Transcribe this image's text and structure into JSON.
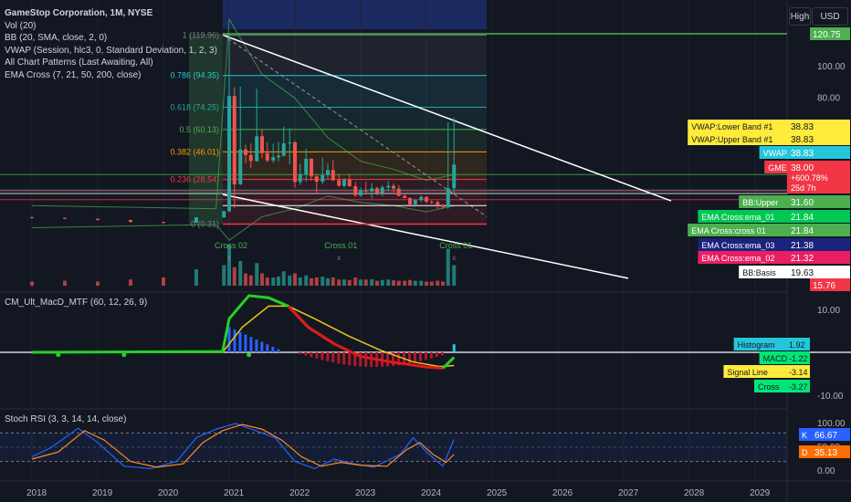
{
  "header": {
    "symbol_line": "GameStop Corporation, 1M, NYSE",
    "indicators": [
      "Vol (20)",
      "BB (20, SMA, close, 2, 0)",
      "VWAP (Session, hlc3, 0, Standard Deviation, 1, 2, 3)",
      "All Chart Patterns (Last Awaiting, All)",
      "EMA Cross (7, 21, 50, 200, close)"
    ],
    "high_button": "High",
    "currency_button": "USD"
  },
  "macd_pane": {
    "legend": "CM_Ult_MacD_MTF (60, 12, 26, 9)"
  },
  "rsi_pane": {
    "legend": "Stoch RSI (3, 3, 14, 14, close)"
  },
  "colors": {
    "background": "#131722",
    "grid": "#1e222d",
    "up": "#26a69a",
    "down": "#ef5350",
    "macd_up": "#26d026",
    "macd_down": "#e0181b",
    "signal": "#f0c419",
    "hist_up": "#2962ff",
    "hist_down": "#b2182b",
    "k_line": "#2962ff",
    "d_line": "#ff8a28",
    "top_band": "#1c2d6b"
  },
  "chart_data": [
    {
      "type": "candlestick",
      "pane": "price",
      "x_ticks": [
        "2018",
        "2019",
        "2020",
        "2021",
        "2022",
        "2023",
        "2024",
        "2025",
        "2026",
        "2027",
        "2028",
        "2029"
      ],
      "y_ticks": [
        "100.00",
        "80.00"
      ],
      "series": [
        {
          "t": 2018.0,
          "o": 4.6,
          "h": 5.2,
          "l": 3.9,
          "c": 4.2
        },
        {
          "t": 2018.5,
          "o": 4.2,
          "h": 4.5,
          "l": 3.4,
          "c": 3.6
        },
        {
          "t": 2019.0,
          "o": 3.6,
          "h": 3.8,
          "l": 2.6,
          "c": 2.9
        },
        {
          "t": 2019.5,
          "o": 2.9,
          "h": 3.1,
          "l": 1.4,
          "c": 1.6
        },
        {
          "t": 2020.0,
          "o": 1.6,
          "h": 1.8,
          "l": 0.7,
          "c": 1.2
        },
        {
          "t": 2020.5,
          "o": 1.2,
          "h": 4.8,
          "l": 1.1,
          "c": 4.5
        },
        {
          "t": 2020.92,
          "o": 4.5,
          "h": 8.8,
          "l": 4.3,
          "c": 8.4
        },
        {
          "t": 2021.0,
          "o": 8.4,
          "h": 120.75,
          "l": 7.8,
          "c": 81.3
        },
        {
          "t": 2021.08,
          "o": 81.3,
          "h": 87.0,
          "l": 10.2,
          "c": 25.4
        },
        {
          "t": 2021.17,
          "o": 25.4,
          "h": 87.3,
          "l": 25.0,
          "c": 47.5
        },
        {
          "t": 2021.25,
          "o": 47.5,
          "h": 50.6,
          "l": 38.8,
          "c": 44.0
        },
        {
          "t": 2021.33,
          "o": 44.0,
          "h": 51.4,
          "l": 35.6,
          "c": 40.2
        },
        {
          "t": 2021.42,
          "o": 40.2,
          "h": 86.0,
          "l": 39.6,
          "c": 55.9
        },
        {
          "t": 2021.5,
          "o": 55.9,
          "h": 60.5,
          "l": 42.0,
          "c": 45.2
        },
        {
          "t": 2021.58,
          "o": 45.2,
          "h": 52.2,
          "l": 39.5,
          "c": 40.6
        },
        {
          "t": 2021.67,
          "o": 40.6,
          "h": 51.2,
          "l": 39.0,
          "c": 42.6
        },
        {
          "t": 2021.75,
          "o": 42.6,
          "h": 52.3,
          "l": 40.0,
          "c": 43.6
        },
        {
          "t": 2021.83,
          "o": 43.6,
          "h": 62.0,
          "l": 43.0,
          "c": 51.4
        },
        {
          "t": 2021.92,
          "o": 51.4,
          "h": 60.9,
          "l": 38.0,
          "c": 52.0
        },
        {
          "t": 2022.0,
          "o": 52.0,
          "h": 53.0,
          "l": 23.4,
          "c": 26.9
        },
        {
          "t": 2022.08,
          "o": 26.9,
          "h": 38.6,
          "l": 25.0,
          "c": 31.8
        },
        {
          "t": 2022.17,
          "o": 31.8,
          "h": 48.0,
          "l": 27.0,
          "c": 41.6
        },
        {
          "t": 2022.25,
          "o": 41.6,
          "h": 42.0,
          "l": 27.7,
          "c": 30.5
        },
        {
          "t": 2022.33,
          "o": 30.5,
          "h": 32.0,
          "l": 19.5,
          "c": 27.1
        },
        {
          "t": 2022.42,
          "o": 27.1,
          "h": 42.3,
          "l": 25.5,
          "c": 31.3
        },
        {
          "t": 2022.5,
          "o": 31.3,
          "h": 38.8,
          "l": 28.6,
          "c": 34.5
        },
        {
          "t": 2022.58,
          "o": 34.5,
          "h": 40.9,
          "l": 27.6,
          "c": 28.0
        },
        {
          "t": 2022.67,
          "o": 28.0,
          "h": 32.0,
          "l": 24.0,
          "c": 24.5
        },
        {
          "t": 2022.75,
          "o": 24.5,
          "h": 29.5,
          "l": 23.3,
          "c": 28.3
        },
        {
          "t": 2022.83,
          "o": 28.3,
          "h": 32.0,
          "l": 24.0,
          "c": 24.2
        },
        {
          "t": 2022.92,
          "o": 24.2,
          "h": 27.0,
          "l": 17.6,
          "c": 18.4
        },
        {
          "t": 2023.0,
          "o": 18.4,
          "h": 23.5,
          "l": 17.5,
          "c": 21.5
        },
        {
          "t": 2023.08,
          "o": 21.5,
          "h": 27.0,
          "l": 19.0,
          "c": 20.9
        },
        {
          "t": 2023.17,
          "o": 20.9,
          "h": 26.3,
          "l": 16.6,
          "c": 23.0
        },
        {
          "t": 2023.25,
          "o": 23.0,
          "h": 24.0,
          "l": 18.5,
          "c": 20.1
        },
        {
          "t": 2023.33,
          "o": 20.1,
          "h": 25.0,
          "l": 17.8,
          "c": 23.5
        },
        {
          "t": 2023.42,
          "o": 23.5,
          "h": 27.6,
          "l": 21.0,
          "c": 24.5
        },
        {
          "t": 2023.5,
          "o": 24.5,
          "h": 26.0,
          "l": 20.6,
          "c": 22.8
        },
        {
          "t": 2023.58,
          "o": 22.8,
          "h": 25.0,
          "l": 17.9,
          "c": 18.1
        },
        {
          "t": 2023.67,
          "o": 18.1,
          "h": 20.0,
          "l": 16.5,
          "c": 16.8
        },
        {
          "t": 2023.75,
          "o": 16.8,
          "h": 17.2,
          "l": 12.1,
          "c": 12.7
        },
        {
          "t": 2023.83,
          "o": 12.7,
          "h": 16.0,
          "l": 11.0,
          "c": 15.5
        },
        {
          "t": 2023.92,
          "o": 15.5,
          "h": 18.5,
          "l": 14.2,
          "c": 17.5
        },
        {
          "t": 2024.0,
          "o": 17.5,
          "h": 18.0,
          "l": 13.2,
          "c": 14.5
        },
        {
          "t": 2024.08,
          "o": 14.5,
          "h": 15.2,
          "l": 13.0,
          "c": 14.2
        },
        {
          "t": 2024.17,
          "o": 14.2,
          "h": 15.0,
          "l": 10.0,
          "c": 12.5
        },
        {
          "t": 2024.25,
          "o": 12.5,
          "h": 13.0,
          "l": 9.95,
          "c": 11.1
        },
        {
          "t": 2024.33,
          "o": 11.1,
          "h": 64.8,
          "l": 10.0,
          "c": 23.0
        },
        {
          "t": 2024.42,
          "o": 23.0,
          "h": 67.5,
          "l": 20.1,
          "c": 38.0
        }
      ],
      "fibonacci": [
        {
          "label": "1 (119.96)",
          "value": 119.96,
          "color": "#787b86"
        },
        {
          "label": "0.786 (94.35)",
          "value": 94.35,
          "color": "#26c6da"
        },
        {
          "label": "0.618 (74.25)",
          "value": 74.25,
          "color": "#26a69a"
        },
        {
          "label": "0.5 (60.13)",
          "value": 60.13,
          "color": "#4caf50"
        },
        {
          "label": "0.382 (46.01)",
          "value": 46.01,
          "color": "#ff9800"
        },
        {
          "label": "0.236 (28.54)",
          "value": 28.54,
          "color": "#f23645"
        },
        {
          "label": "0 (0.31)",
          "value": 0.31,
          "color": "#787b86"
        }
      ],
      "cross_labels": [
        "Cross 02",
        "Cross 01",
        "Cross 01"
      ],
      "price_labels": [
        {
          "text": "120.75",
          "value": 120.75,
          "bg": "#4caf50",
          "fg": "#ffffff"
        },
        {
          "text": "VWAP:Lower Band #1",
          "value2": "38.83",
          "bg": "#ffeb3b",
          "fg": "#131722"
        },
        {
          "text": "VWAP:Upper Band #1",
          "value2": "38.83",
          "bg": "#ffeb3b",
          "fg": "#131722"
        },
        {
          "text": "VWAP",
          "value2": "38.83",
          "bg": "#26c6da",
          "fg": "#ffffff"
        },
        {
          "text": "GME",
          "value2": "38.00",
          "extra": [
            "+600.78%",
            "25d 7h"
          ],
          "bg": "#f23645",
          "fg": "#ffffff"
        },
        {
          "text": "BB:Upper",
          "value2": "31.60",
          "bg": "#4caf50",
          "fg": "#ffffff"
        },
        {
          "text": "EMA Cross:ema_01",
          "value2": "21.84",
          "bg": "#00c853",
          "fg": "#ffffff"
        },
        {
          "text": "EMA Cross:cross 01",
          "value2": "21.84",
          "bg": "#4caf50",
          "fg": "#ffffff"
        },
        {
          "text": "EMA Cross:ema_03",
          "value2": "21.38",
          "bg": "#1a237e",
          "fg": "#ffffff"
        },
        {
          "text": "EMA Cross:ema_02",
          "value2": "21.32",
          "bg": "#e91e63",
          "fg": "#ffffff"
        },
        {
          "text": "BB:Basis",
          "value2": "19.63",
          "bg": "#ffffff",
          "fg": "#131722"
        },
        {
          "text": "15.76",
          "bg": "#f23645",
          "fg": "#ffffff"
        }
      ]
    },
    {
      "type": "line",
      "pane": "macd",
      "y_ticks": [
        "10.00",
        "-10.00"
      ],
      "labels": [
        {
          "text": "Histogram",
          "value": "1.92",
          "bg": "#26c6da",
          "fg": "#131722"
        },
        {
          "text": "MACD",
          "value": "-1.22",
          "bg": "#00e676",
          "fg": "#131722"
        },
        {
          "text": "Signal Line",
          "value": "-3.14",
          "bg": "#ffeb3b",
          "fg": "#131722"
        },
        {
          "text": "Cross",
          "value": "-3.27",
          "bg": "#00e676",
          "fg": "#131722"
        }
      ]
    },
    {
      "type": "line",
      "pane": "stoch_rsi",
      "y_ticks": [
        "100.00",
        "50.00",
        "0.00"
      ],
      "labels": [
        {
          "text": "K",
          "value": "66.67",
          "bg": "#2962ff",
          "fg": "#ffffff"
        },
        {
          "text": "D",
          "value": "35.13",
          "bg": "#ff6d00",
          "fg": "#ffffff"
        }
      ]
    }
  ]
}
